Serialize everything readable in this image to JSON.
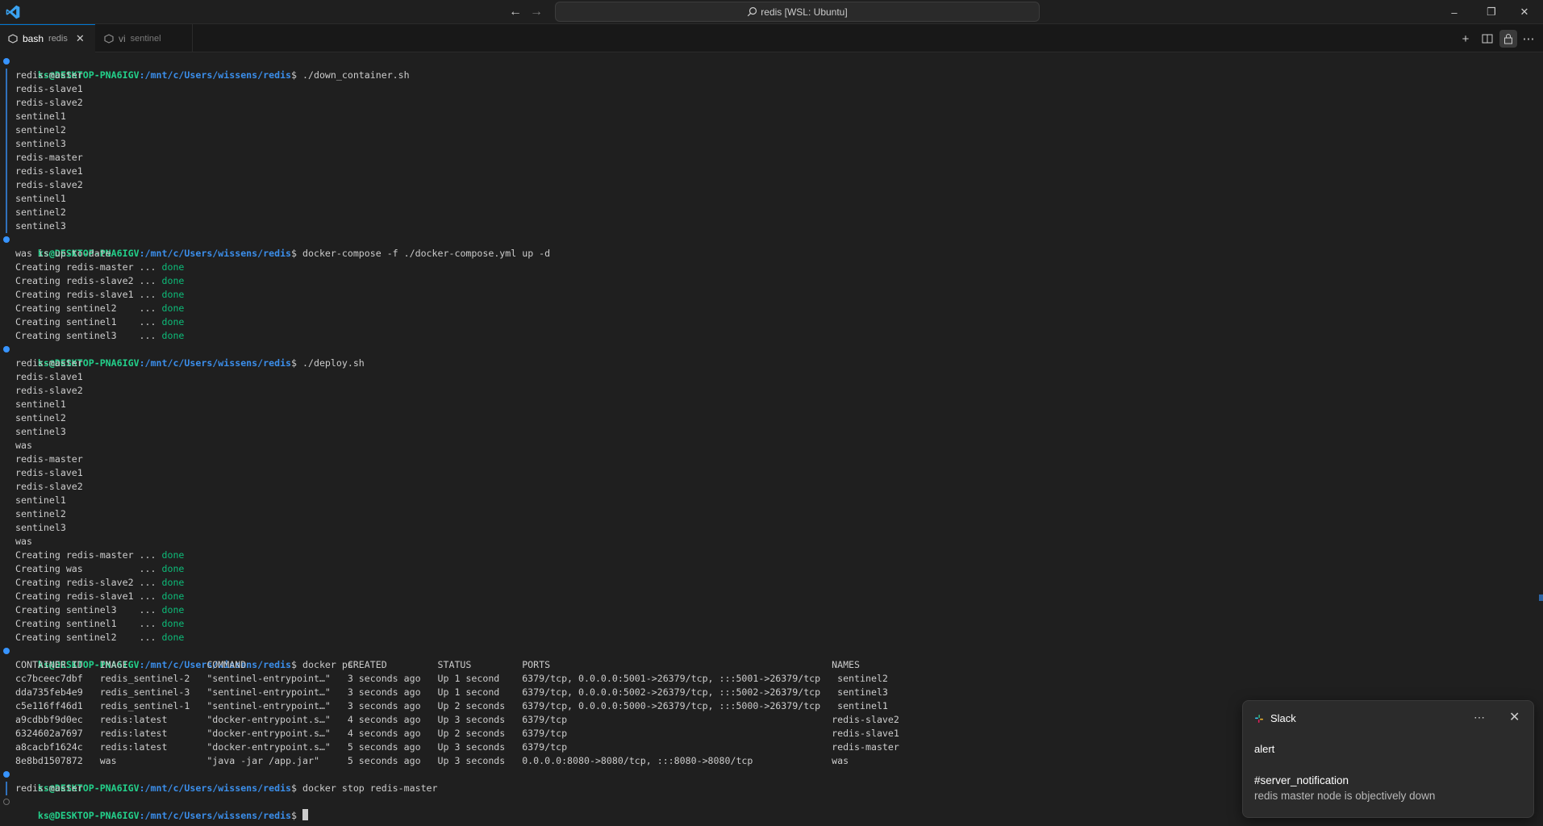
{
  "titlebar": {
    "search_text": "redis [WSL: Ubuntu]",
    "icons": [
      "vscode-logo-icon",
      "arrow-left-icon",
      "arrow-right-icon",
      "search-icon",
      "minimize-icon",
      "restore-icon",
      "close-icon"
    ]
  },
  "tabs": [
    {
      "label": "bash",
      "desc": "redis",
      "active": true
    },
    {
      "label": "vi",
      "desc": "sentinel",
      "active": false
    }
  ],
  "toolbar_icons": [
    "new-terminal-icon",
    "split-terminal-icon",
    "lock-icon",
    "more-icon"
  ],
  "colors": {
    "accent": "#0078d4",
    "prompt_user": "#23d18b",
    "prompt_path": "#3b8eea",
    "done": "#0dbc79",
    "mark": "#3794ff"
  },
  "terminal": {
    "prompt_user": "ks@DESKTOP-PNA6IGV",
    "prompt_path": ":/mnt/c/Users/wissens/redis",
    "prompt_sep": "$ ",
    "commands": [
      "./down_container.sh",
      "docker-compose -f ./docker-compose.yml up -d",
      "./deploy.sh",
      "docker ps",
      "docker stop redis-master"
    ],
    "out_down": [
      "redis-master",
      "redis-slave1",
      "redis-slave2",
      "sentinel1",
      "sentinel2",
      "sentinel3",
      "redis-master",
      "redis-slave1",
      "redis-slave2",
      "sentinel1",
      "sentinel2",
      "sentinel3"
    ],
    "out_compose_head": "was is up-to-date",
    "out_compose": [
      {
        "text": "Creating redis-master ... ",
        "status": "done"
      },
      {
        "text": "Creating redis-slave2 ... ",
        "status": "done"
      },
      {
        "text": "Creating redis-slave1 ... ",
        "status": "done"
      },
      {
        "text": "Creating sentinel2    ... ",
        "status": "done"
      },
      {
        "text": "Creating sentinel1    ... ",
        "status": "done"
      },
      {
        "text": "Creating sentinel3    ... ",
        "status": "done"
      }
    ],
    "out_deploy": [
      "redis-master",
      "redis-slave1",
      "redis-slave2",
      "sentinel1",
      "sentinel2",
      "sentinel3",
      "was",
      "redis-master",
      "redis-slave1",
      "redis-slave2",
      "sentinel1",
      "sentinel2",
      "sentinel3",
      "was"
    ],
    "out_deploy_create": [
      {
        "text": "Creating redis-master ... ",
        "status": "done"
      },
      {
        "text": "Creating was          ... ",
        "status": "done"
      },
      {
        "text": "Creating redis-slave2 ... ",
        "status": "done"
      },
      {
        "text": "Creating redis-slave1 ... ",
        "status": "done"
      },
      {
        "text": "Creating sentinel3    ... ",
        "status": "done"
      },
      {
        "text": "Creating sentinel1    ... ",
        "status": "done"
      },
      {
        "text": "Creating sentinel2    ... ",
        "status": "done"
      }
    ],
    "ps_table": [
      "CONTAINER ID   IMAGE              COMMAND                  CREATED         STATUS         PORTS                                                  NAMES",
      "cc7bceec7dbf   redis_sentinel-2   \"sentinel-entrypoint…\"   3 seconds ago   Up 1 second    6379/tcp, 0.0.0.0:5001->26379/tcp, :::5001->26379/tcp   sentinel2",
      "dda735feb4e9   redis_sentinel-3   \"sentinel-entrypoint…\"   3 seconds ago   Up 1 second    6379/tcp, 0.0.0.0:5002->26379/tcp, :::5002->26379/tcp   sentinel3",
      "c5e116ff46d1   redis_sentinel-1   \"sentinel-entrypoint…\"   3 seconds ago   Up 2 seconds   6379/tcp, 0.0.0.0:5000->26379/tcp, :::5000->26379/tcp   sentinel1",
      "a9cdbbf9d0ec   redis:latest       \"docker-entrypoint.s…\"   4 seconds ago   Up 3 seconds   6379/tcp                                               redis-slave2",
      "6324602a7697   redis:latest       \"docker-entrypoint.s…\"   4 seconds ago   Up 2 seconds   6379/tcp                                               redis-slave1",
      "a8cacbf1624c   redis:latest       \"docker-entrypoint.s…\"   5 seconds ago   Up 3 seconds   6379/tcp                                               redis-master",
      "8e8bd1507872   was                \"java -jar /app.jar\"     5 seconds ago   Up 3 seconds   0.0.0.0:8080->8080/tcp, :::8080->8080/tcp              was"
    ],
    "out_stop": "redis-master"
  },
  "notification": {
    "app": "Slack",
    "title": "alert",
    "channel": "#server_notification",
    "message": "redis master node is objectively down"
  }
}
